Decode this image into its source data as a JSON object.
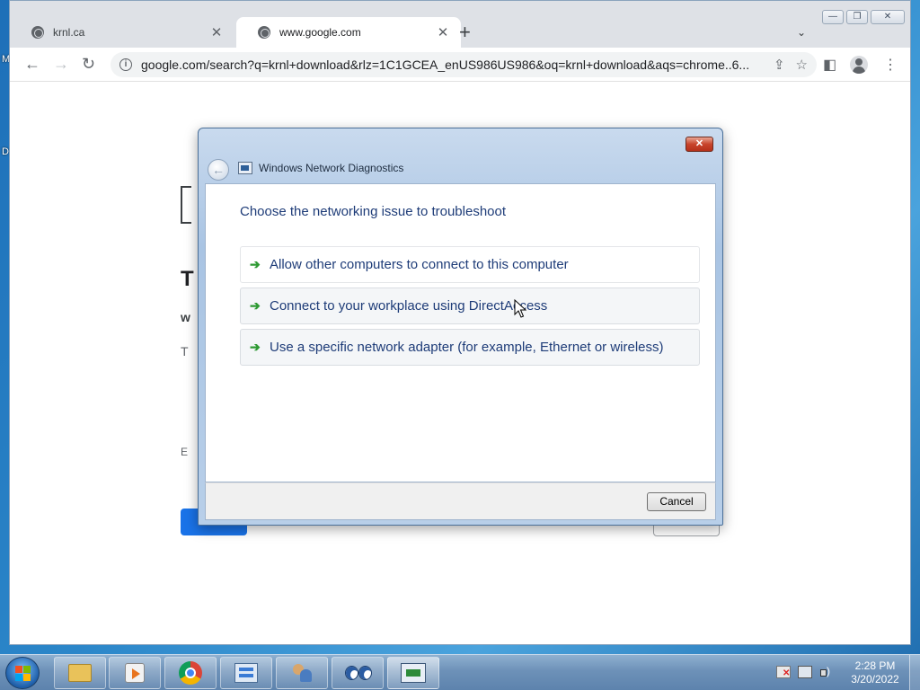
{
  "desktop": {
    "fragments": [
      "M",
      "D"
    ]
  },
  "browser": {
    "tabs": [
      {
        "title": "krnl.ca",
        "active": false
      },
      {
        "title": "www.google.com",
        "active": true
      }
    ],
    "new_tab": "+",
    "tab_search": "⌄",
    "window_controls": {
      "minimize": "—",
      "maximize": "❐",
      "close": "✕"
    },
    "nav": {
      "back": "←",
      "forward": "→",
      "reload": "↻"
    },
    "address": {
      "info": "i",
      "url": "google.com/search?q=krnl+download&rlz=1C1GCEA_enUS986US986&oq=krnl+download&aqs=chrome..6..."
    },
    "page_fragments": {
      "big_t": "T",
      "bold_w": "w",
      "text_t": "T",
      "text_e": "E"
    }
  },
  "dialog": {
    "title": "Windows Network Diagnostics",
    "close": "✕",
    "back": "←",
    "heading": "Choose the networking issue to troubleshoot",
    "options": [
      {
        "label": "Allow other computers to connect to this computer",
        "icon": "green-arrow-icon"
      },
      {
        "label": "Connect to your workplace using DirectAccess",
        "icon": "green-arrow-icon"
      },
      {
        "label": "Use a specific network adapter (for example, Ethernet or wireless)",
        "icon": "green-arrow-icon"
      }
    ],
    "arrow_glyph": "➔",
    "cancel": "Cancel"
  },
  "taskbar": {
    "apps": [
      "file-explorer",
      "windows-media-player",
      "google-chrome",
      "control-panel",
      "user-accounts",
      "eyes-app",
      "network-diagnostics"
    ],
    "clock": {
      "time": "2:28 PM",
      "date": "3/20/2022"
    }
  }
}
